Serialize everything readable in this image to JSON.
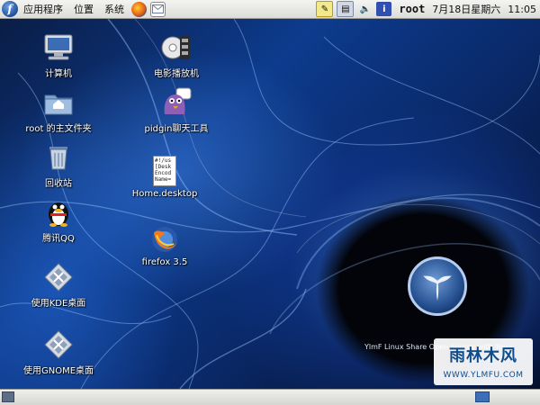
{
  "panel": {
    "menus": [
      {
        "label": "应用程序"
      },
      {
        "label": "位置"
      },
      {
        "label": "系统"
      }
    ],
    "user": "root",
    "date": "7月18日星期六",
    "time": "11:05"
  },
  "desktop": {
    "icons": [
      {
        "label": "计算机",
        "icon": "computer-icon"
      },
      {
        "label": "root 的主文件夹",
        "icon": "home-folder-icon"
      },
      {
        "label": "回收站",
        "icon": "trash-icon"
      },
      {
        "label": "腾讯QQ",
        "icon": "qq-penguin-icon"
      },
      {
        "label": "使用KDE桌面",
        "icon": "kde-icon"
      },
      {
        "label": "使用GNOME桌面",
        "icon": "gnome-icon"
      },
      {
        "label": "电影播放机",
        "icon": "movie-player-icon"
      },
      {
        "label": "pidgin聊天工具",
        "icon": "pidgin-icon"
      },
      {
        "label": "Home.desktop",
        "icon": "desktop-file-icon",
        "preview": [
          "#!/us",
          "[Desk",
          "Encod",
          "Name="
        ]
      },
      {
        "label": "firefox 3.5",
        "icon": "firefox-icon"
      }
    ]
  },
  "wallpaper": {
    "slogan": "YlmF Linux Share Open Source with You",
    "watermark_logo": "雨林木风",
    "watermark_url": "WWW.YLMFU.COM"
  },
  "colors": {
    "panel_bg": "#e6e6e3",
    "desktop_blue": "#0d3b8d",
    "label_text": "#ffffff"
  }
}
